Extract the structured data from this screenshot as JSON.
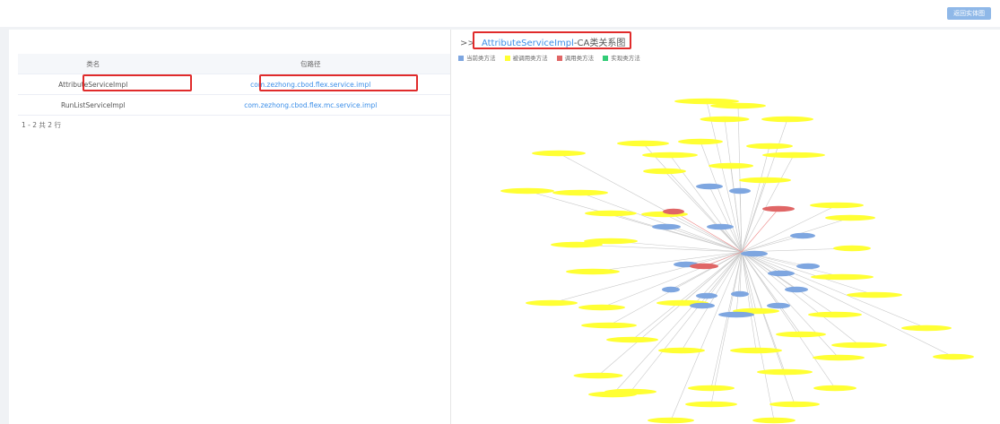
{
  "toolbar": {
    "back_label": "返回实体图"
  },
  "table": {
    "headers": [
      "类名",
      "包路径"
    ],
    "rows": [
      {
        "class": "AttributeServiceImpl",
        "package": "com.zezhong.cbod.flex.service.impl"
      },
      {
        "class": "RunListServiceImpl",
        "package": "com.zezhong.cbod.flex.mc.service.impl"
      }
    ]
  },
  "pager": {
    "text": "1 - 2 共 2 行"
  },
  "graph_panel": {
    "prefix": ">>",
    "class_name": "AttributeServiceImpl",
    "title_suffix": "-CA类关系图",
    "legend": [
      {
        "label": "当前类方法",
        "color": "#7ea6e0"
      },
      {
        "label": "被调用类方法",
        "color": "#ffff33"
      },
      {
        "label": "调用类方法",
        "color": "#e06666"
      },
      {
        "label": "实现类方法",
        "color": "#33cc77"
      }
    ]
  },
  "colors": {
    "accent": "#3b8ee8",
    "highlight": "#e02b2b",
    "node_yellow": "#ffff33",
    "node_blue": "#7ea6e0",
    "node_red": "#e06666"
  }
}
